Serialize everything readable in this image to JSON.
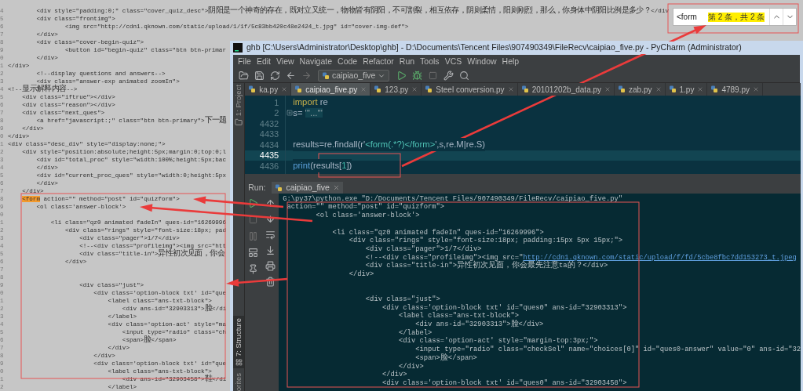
{
  "source_view": {
    "lines": [
      {
        "number": "4",
        "text": "        <div style=\"padding:0;\" class=\"cover_quiz_desc\">阴阳是一个神奇的存在，既对立又统一，物物皆有阴阳，不可割裂，相互依存，阴则柔情，阳则刚烈，那么，你身体中阴阳比例是多少？</div"
      },
      {
        "number": "5",
        "text": "        <div class=\"frontimg\">"
      },
      {
        "number": "6",
        "text": "                <img src=\"http://cdn1.qknown.com/static/upload/1/1f/5c83bb420c48e2424_t.jpg\" id=\"cover-img-def\">"
      },
      {
        "number": "7",
        "text": "        </div>"
      },
      {
        "number": "8",
        "text": "        <div class=\"cover-begin-quiz\">"
      },
      {
        "number": "9",
        "text": "                <button id=\"begin-quiz\" class=\"btn btn-primar"
      },
      {
        "number": "0",
        "text": "        </div>"
      },
      {
        "number": "1",
        "text": "</div>"
      },
      {
        "number": "2",
        "text": "        <!--display questions and answers-->"
      },
      {
        "number": "3",
        "text": "        <div class=\"answer-exp animated zoomIn\">"
      },
      {
        "number": "4",
        "text": "<!--显示解释内容-->"
      },
      {
        "number": "5",
        "text": "    <div class=\"iftrue\"></div>"
      },
      {
        "number": "6",
        "text": "    <div class=\"reason\"></div>"
      },
      {
        "number": "7",
        "text": "    <div class=\"next_ques\">"
      },
      {
        "number": "8",
        "text": "        <a href=\"javascript:;\" class=\"btn btn-primary\">下一题"
      },
      {
        "number": "9",
        "text": "    </div>"
      },
      {
        "number": "0",
        "text": "</div>"
      },
      {
        "number": "1",
        "text": "<div class=\"desc_div\" style=\"display:none;\">"
      },
      {
        "number": "2",
        "text": "    <div style=\"position:absolute;height:5px;margin:0;top:0;l"
      },
      {
        "number": "3",
        "text": "        <div id=\"total_proc\" style=\"width:100%;height:5px;bac"
      },
      {
        "number": "4",
        "text": "        </div>"
      },
      {
        "number": "5",
        "text": "        <div id=\"current_proc_ques\" style=\"width:0;height:5px"
      },
      {
        "number": "6",
        "text": "        </div>"
      },
      {
        "number": "7",
        "text": "    </div>"
      },
      {
        "number": "8",
        "match": "<form",
        "text": " action=\"\" method=\"post\" id=\"quizform\">"
      },
      {
        "number": "9",
        "text": "        <ol class='answer-block'>"
      },
      {
        "number": "0"
      },
      {
        "number": "1",
        "text": "            <li class=\"qz0 animated fadeIn\" ques-id=\"16269996"
      },
      {
        "number": "2",
        "text": "                <div class=\"rings\" style=\"font-size:18px; pad"
      },
      {
        "number": "3",
        "text": "                    <div class=\"pager\">1/7</div>"
      },
      {
        "number": "4",
        "text": "                    <!--<div class=\"profileimg\"><img src=\"htt"
      },
      {
        "number": "5",
        "text": "                    <div class=\"title-in\">异性初次见面，你会"
      },
      {
        "number": "6",
        "text": "                </div>"
      },
      {
        "number": "7"
      },
      {
        "number": "8"
      },
      {
        "number": "9",
        "text": "                    <div class=\"just\">"
      },
      {
        "number": "0",
        "text": "                        <div class='option-block txt' id=\"que"
      },
      {
        "number": "1",
        "text": "                            <label class=\"ans-txt-block\">"
      },
      {
        "number": "2",
        "text": "                                <div ans-id=\"32903313\">脸</di"
      },
      {
        "number": "3",
        "text": "                            </label>"
      },
      {
        "number": "4",
        "text": "                            <div class='option-act' style=\"ma"
      },
      {
        "number": "5",
        "text": "                                <input type=\"radio\" class=\"ch"
      },
      {
        "number": "6",
        "text": "                                <span>脸</span>"
      },
      {
        "number": "7",
        "text": "                            </div>"
      },
      {
        "number": "8",
        "text": "                        </div>"
      },
      {
        "number": "9",
        "text": "                        <div class='option-block txt' id=\"que"
      },
      {
        "number": "0",
        "text": "                            <label class=\"ans-txt-block\">"
      },
      {
        "number": "1",
        "text": "                                <div ans-id=\"32903458\">鞋</di"
      },
      {
        "number": "2",
        "text": "                            </label>"
      }
    ]
  },
  "find_bar": {
    "query": "<form",
    "match_count": "第 2 条，共 2 条"
  },
  "ide": {
    "title": "ghb [C:\\Users\\Administrator\\Desktop\\ghb] - D:\\Documents\\Tencent Files\\907490349\\FileRecv\\caipiao_five.py - PyCharm (Administrator)",
    "menu": [
      "File",
      "Edit",
      "View",
      "Navigate",
      "Code",
      "Refactor",
      "Run",
      "Tools",
      "VCS",
      "Window",
      "Help"
    ],
    "run_config": "caipiao_five",
    "tabs": [
      {
        "label": "ka.py",
        "selected": false
      },
      {
        "label": "caipiao_five.py",
        "selected": true
      },
      {
        "label": "123.py",
        "selected": false
      },
      {
        "label": "Steel conversion.py",
        "selected": false
      },
      {
        "label": "20101202b_data.py",
        "selected": false
      },
      {
        "label": "zab.py",
        "selected": false
      },
      {
        "label": "1.py",
        "selected": false
      },
      {
        "label": "4789.py",
        "selected": false
      }
    ],
    "tool_windows": [
      {
        "label": "1: Project"
      },
      {
        "label": "7: Structure"
      },
      {
        "label": "orites"
      }
    ],
    "editor": [
      {
        "number": "1",
        "current": false,
        "tokens": [
          {
            "kind": "keyword",
            "text": "import"
          },
          {
            "kind": "plain",
            "text": " re"
          }
        ]
      },
      {
        "number": "2",
        "current": false,
        "folded": true,
        "tokens": [
          {
            "kind": "plain",
            "text": "s= "
          },
          {
            "kind": "string",
            "text": "'''...'''"
          }
        ]
      },
      {
        "number": "4432",
        "current": false
      },
      {
        "number": "4433",
        "current": false
      },
      {
        "number": "4434",
        "current": false,
        "tokens": [
          {
            "kind": "plain",
            "text": "results=re.findall(r'"
          },
          {
            "kind": "regex",
            "text": "<form(.*?)</form>"
          },
          {
            "kind": "plain",
            "text": "',s,re.M|re.S)"
          }
        ]
      },
      {
        "number": "4435",
        "current": true
      },
      {
        "number": "4436",
        "current": false,
        "tokens": [
          {
            "kind": "builtin",
            "text": "print"
          },
          {
            "kind": "plain",
            "text": "(results["
          },
          {
            "kind": "number",
            "text": "1"
          },
          {
            "kind": "plain",
            "text": "])"
          }
        ]
      }
    ],
    "run": {
      "label": "Run:",
      "tab": "caipiao_five",
      "output": [
        {
          "text": "G:\\py37\\python.exe \"D:/Documents/Tencent Files/907490349/FileRecv/caipiao_five.py\""
        },
        {
          "text": " action=\"\" method=\"post\" id=\"quizform\">"
        },
        {
          "text": "        <ol class='answer-block'>"
        },
        {
          "kind": "blank"
        },
        {
          "text": "            <li class=\"qz0 animated fadeIn\" ques-id=\"16269996\">"
        },
        {
          "text": "                <div class=\"rings\" style=\"font-size:18px; padding:15px 5px 15px;\">"
        },
        {
          "text": "                    <div class=\"pager\">1/7</div>"
        },
        {
          "text": "                    <!--<div class=\"profileimg\"><img src=\"",
          "link": "http://cdn1.qknown.com/static/upload/f/fd/5cbe8fbc7dd153273_t.jpeg"
        },
        {
          "text": "                    <div class=\"title-in\">异性初次见面，你会最先注意ta的？</div>"
        },
        {
          "text": "                </div>"
        },
        {
          "kind": "blank"
        },
        {
          "kind": "blank"
        },
        {
          "text": "                    <div class=\"just\">"
        },
        {
          "text": "                        <div class='option-block txt' id=\"ques0\" ans-id=\"32903313\">"
        },
        {
          "text": "                            <label class=\"ans-txt-block\">"
        },
        {
          "text": "                                <div ans-id=\"32903313\">脸</div>"
        },
        {
          "text": "                            </label>"
        },
        {
          "text": "                            <div class='option-act' style=\"margin-top:3px;\">"
        },
        {
          "text": "                                <input type=\"radio\" class=\"checkSel\" name=\"choices[0]\" id=\"ques0-answer\" value=\"0\" ans-id=\"32"
        },
        {
          "text": "                                <span>脸</span>"
        },
        {
          "text": "                            </div>"
        },
        {
          "text": "                        </div>"
        },
        {
          "text": "                        <div class='option-block txt' id=\"ques0\" ans-id=\"32903458\">"
        }
      ]
    }
  }
}
